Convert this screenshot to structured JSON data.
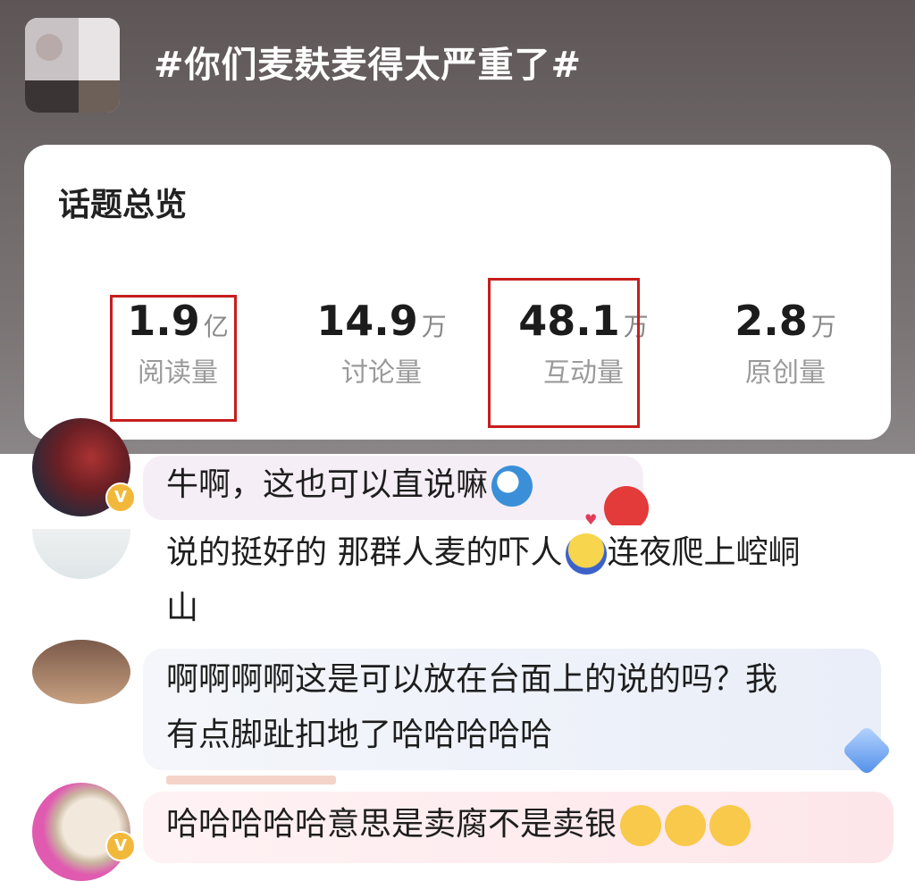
{
  "topic": {
    "title": "#你们麦麸麦得太严重了#"
  },
  "overview": {
    "title": "话题总览",
    "stats": [
      {
        "value": "1.9",
        "unit": "亿",
        "label": "阅读量"
      },
      {
        "value": "14.9",
        "unit": "万",
        "label": "讨论量"
      },
      {
        "value": "48.1",
        "unit": "万",
        "label": "互动量"
      },
      {
        "value": "2.8",
        "unit": "万",
        "label": "原创量"
      }
    ]
  },
  "comments": [
    {
      "text": "牛啊，这也可以直说嘛",
      "emoji": "doraemon-emoji"
    },
    {
      "text_line1": "说的挺好的 那群人麦的吓人",
      "text_line1b": "连夜爬上崆峒",
      "text_line2": "山",
      "emoji": "shy-emoji"
    },
    {
      "text_line1": "啊啊啊啊这是可以放在台面上的说的吗？我",
      "text_line2": "有点脚趾扣地了哈哈哈哈哈"
    },
    {
      "text": "哈哈哈哈哈意思是卖腐不是卖银",
      "emoji": "smirk-emoji"
    }
  ],
  "colors": {
    "highlight": "#c71d1d",
    "badge": "#f2b83a"
  }
}
